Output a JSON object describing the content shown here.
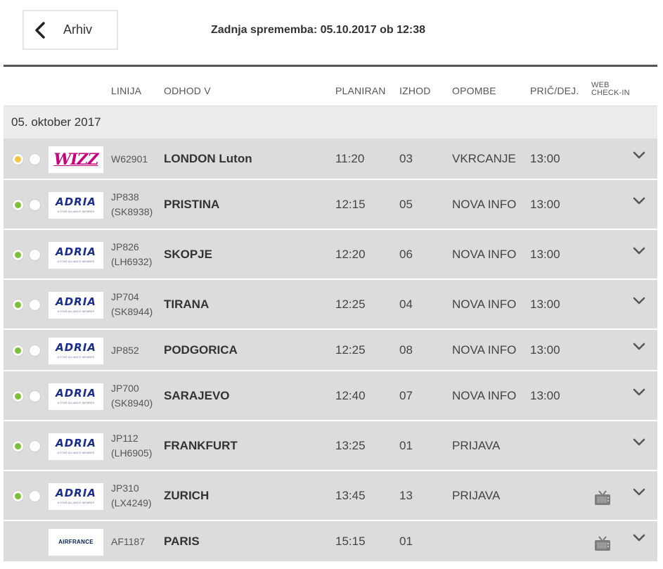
{
  "header": {
    "back_label": "Arhiv",
    "last_change": "Zadnja sprememba: 05.10.2017 ob 12:38"
  },
  "columns": {
    "linija": "LINIJA",
    "odhod": "ODHOD V",
    "planiran": "PLANIRAN",
    "izhod": "IZHOD",
    "opombe": "OPOMBE",
    "pric": "PRIČ/DEJ.",
    "web_line1": "WEB",
    "web_line2": "CHECK-IN"
  },
  "date_label": "05. oktober 2017",
  "colors": {
    "status_yellow": "#f2c744",
    "status_green": "#7fbe3b",
    "row_bg": "#dcdcdc",
    "date_bg": "#ececec"
  },
  "flights": [
    {
      "status": "yellow",
      "airline": "wizz",
      "logo_text": "WIZZ",
      "flight": "W62901",
      "codeshare": "",
      "destination": "LONDON Luton",
      "planned": "11:20",
      "gate": "03",
      "remark": "VKRCANJE",
      "actual": "13:00",
      "web_checkin": false
    },
    {
      "status": "green",
      "airline": "adria",
      "logo_text": "ADRIA",
      "logo_sub": "A STAR ALLIANCE MEMBER",
      "flight": "JP838",
      "codeshare": "(SK8938)",
      "destination": "PRISTINA",
      "planned": "12:15",
      "gate": "05",
      "remark": "NOVA INFO",
      "actual": "13:00",
      "web_checkin": false
    },
    {
      "status": "green",
      "airline": "adria",
      "logo_text": "ADRIA",
      "logo_sub": "A STAR ALLIANCE MEMBER",
      "flight": "JP826",
      "codeshare": "(LH6932)",
      "destination": "SKOPJE",
      "planned": "12:20",
      "gate": "06",
      "remark": "NOVA INFO",
      "actual": "13:00",
      "web_checkin": false
    },
    {
      "status": "green",
      "airline": "adria",
      "logo_text": "ADRIA",
      "logo_sub": "A STAR ALLIANCE MEMBER",
      "flight": "JP704",
      "codeshare": "(SK8944)",
      "destination": "TIRANA",
      "planned": "12:25",
      "gate": "04",
      "remark": "NOVA INFO",
      "actual": "13:00",
      "web_checkin": false
    },
    {
      "status": "green",
      "airline": "adria",
      "logo_text": "ADRIA",
      "logo_sub": "A STAR ALLIANCE MEMBER",
      "flight": "JP852",
      "codeshare": "",
      "destination": "PODGORICA",
      "planned": "12:25",
      "gate": "08",
      "remark": "NOVA INFO",
      "actual": "13:00",
      "web_checkin": false
    },
    {
      "status": "green",
      "airline": "adria",
      "logo_text": "ADRIA",
      "logo_sub": "A STAR ALLIANCE MEMBER",
      "flight": "JP700",
      "codeshare": "(SK8940)",
      "destination": "SARAJEVO",
      "planned": "12:40",
      "gate": "07",
      "remark": "NOVA INFO",
      "actual": "13:00",
      "web_checkin": false
    },
    {
      "status": "green",
      "airline": "adria",
      "logo_text": "ADRIA",
      "logo_sub": "A STAR ALLIANCE MEMBER",
      "flight": "JP112",
      "codeshare": "(LH6905)",
      "destination": "FRANKFURT",
      "planned": "13:25",
      "gate": "01",
      "remark": "PRIJAVA",
      "actual": "",
      "web_checkin": false
    },
    {
      "status": "green",
      "airline": "adria",
      "logo_text": "ADRIA",
      "logo_sub": "A STAR ALLIANCE MEMBER",
      "flight": "JP310",
      "codeshare": "(LX4249)",
      "destination": "ZURICH",
      "planned": "13:45",
      "gate": "13",
      "remark": "PRIJAVA",
      "actual": "",
      "web_checkin": true
    },
    {
      "status": "none",
      "airline": "airfrance",
      "logo_text": "AIRFRANCE",
      "flight": "AF1187",
      "codeshare": "",
      "destination": "PARIS",
      "planned": "15:15",
      "gate": "01",
      "remark": "",
      "actual": "",
      "web_checkin": true
    }
  ]
}
